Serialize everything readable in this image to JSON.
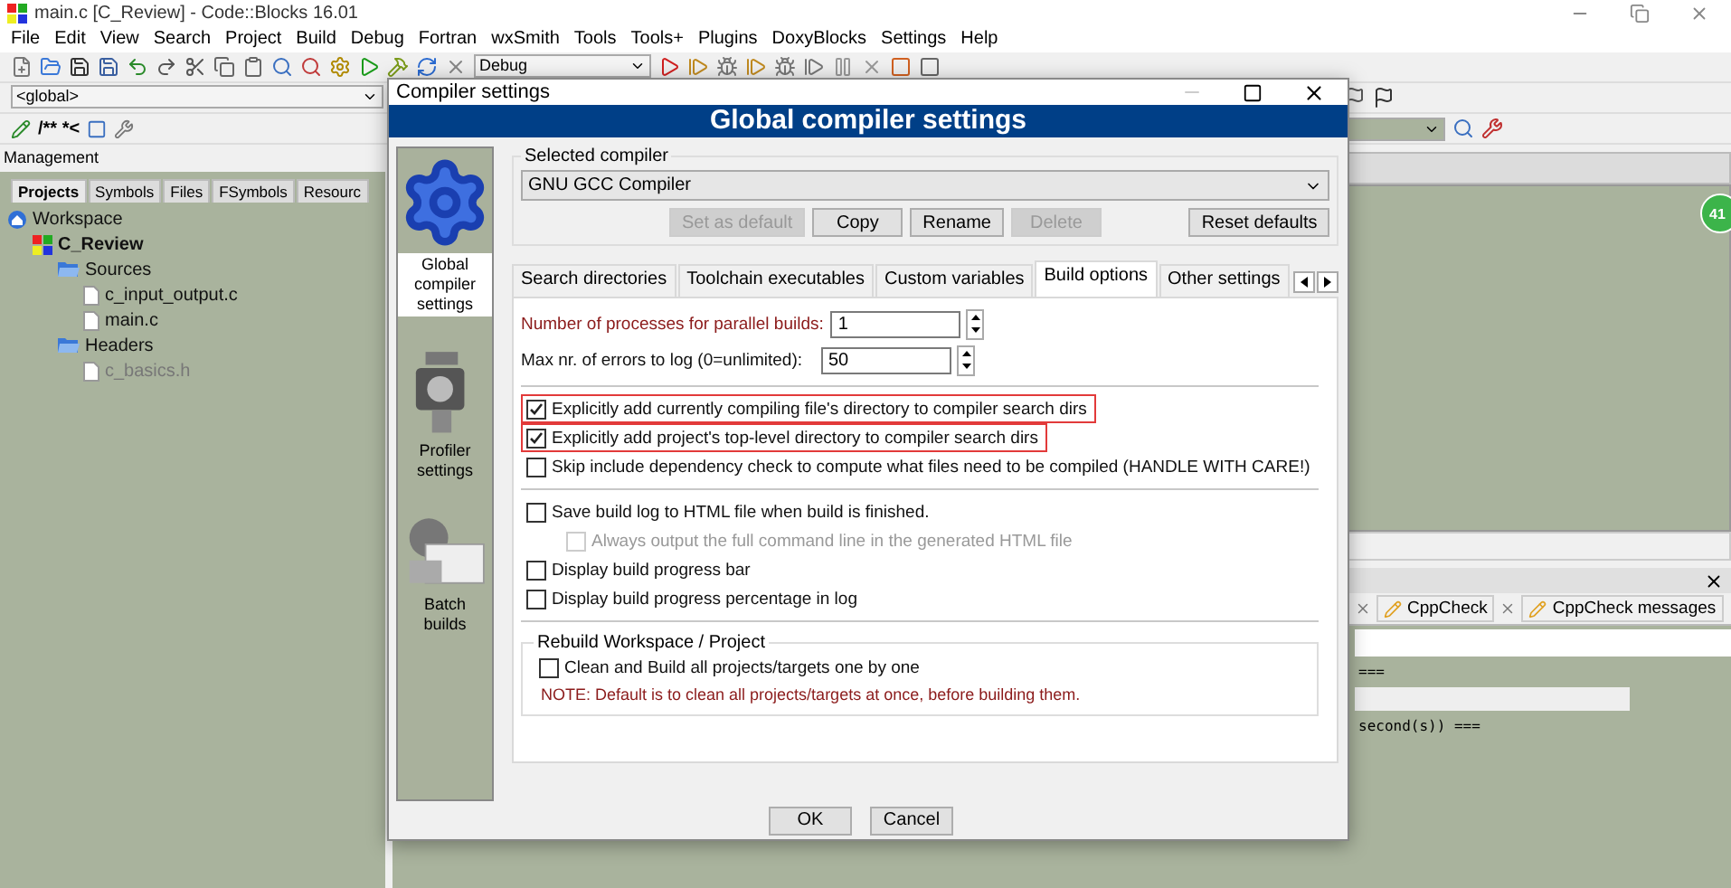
{
  "window": {
    "title": "main.c [C_Review] - Code::Blocks 16.01"
  },
  "menu": [
    "File",
    "Edit",
    "View",
    "Search",
    "Project",
    "Build",
    "Debug",
    "Fortran",
    "wxSmith",
    "Tools",
    "Tools+",
    "Plugins",
    "DoxyBlocks",
    "Settings",
    "Help"
  ],
  "toolbar": {
    "build_target": "Debug",
    "scope": "<global>",
    "doc_comment": "/** *<"
  },
  "management": {
    "title": "Management",
    "tabs": [
      {
        "label": "Projects",
        "selected": true
      },
      {
        "label": "Symbols",
        "selected": false
      },
      {
        "label": "Files",
        "selected": false
      },
      {
        "label": "FSymbols",
        "selected": false
      },
      {
        "label": "Resourc",
        "selected": false
      }
    ],
    "tree": [
      {
        "label": "Workspace",
        "kind": "workspace",
        "disabled": false,
        "children": [
          {
            "label": "C_Review",
            "kind": "project",
            "disabled": false,
            "children": [
              {
                "label": "Sources",
                "kind": "folder",
                "disabled": false,
                "children": [
                  {
                    "label": "c_input_output.c",
                    "kind": "file",
                    "disabled": false
                  },
                  {
                    "label": "main.c",
                    "kind": "file",
                    "disabled": false
                  }
                ]
              },
              {
                "label": "Headers",
                "kind": "folder",
                "disabled": false,
                "children": [
                  {
                    "label": "c_basics.h",
                    "kind": "file",
                    "disabled": true
                  }
                ]
              }
            ]
          }
        ]
      }
    ]
  },
  "editor": {
    "badge": "41"
  },
  "logs": {
    "tabs": [
      {
        "label": "CppCheck",
        "selected": false
      },
      {
        "label": "CppCheck messages",
        "selected": false
      }
    ],
    "lines": [
      {
        "kind": "blank"
      },
      {
        "text": "===",
        "kind": "plain"
      },
      {
        "kind": "shaded"
      },
      {
        "text": "second(s)) ===",
        "kind": "plain"
      }
    ]
  },
  "dialog": {
    "title": "Compiler settings",
    "banner": "Global compiler settings",
    "nav": [
      {
        "label": "Global compiler settings",
        "kind": "gear",
        "selected": true
      },
      {
        "label": "Profiler settings",
        "kind": "profiler",
        "selected": false
      },
      {
        "label": "Batch builds",
        "kind": "batch",
        "selected": false
      }
    ],
    "compiler_group": "Selected compiler",
    "compiler": "GNU GCC Compiler",
    "compiler_buttons": [
      {
        "label": "Set as default",
        "disabled": true
      },
      {
        "label": "Copy",
        "disabled": false
      },
      {
        "label": "Rename",
        "disabled": false
      },
      {
        "label": "Delete",
        "disabled": true
      },
      {
        "label": "Reset defaults",
        "disabled": false
      }
    ],
    "tabs": [
      {
        "label": "Search directories",
        "selected": false
      },
      {
        "label": "Toolchain executables",
        "selected": false
      },
      {
        "label": "Custom variables",
        "selected": false
      },
      {
        "label": "Build options",
        "selected": true
      },
      {
        "label": "Other settings",
        "selected": false
      }
    ],
    "fields": [
      {
        "label": "Number of processes for parallel builds:",
        "value": "1",
        "emphasized": true
      },
      {
        "label": "Max nr. of errors to log (0=unlimited):",
        "value": "50",
        "emphasized": false
      }
    ],
    "option_groups": [
      [
        {
          "label": "Explicitly add currently compiling file's directory to compiler search dirs",
          "checked": true,
          "disabled": false,
          "highlighted": true
        },
        {
          "label": "Explicitly add project's top-level directory to compiler search dirs",
          "checked": true,
          "disabled": false,
          "highlighted": true
        },
        {
          "label": "Skip include dependency check to compute what files need to be compiled (HANDLE WITH CARE!)",
          "checked": false,
          "disabled": false,
          "highlighted": false
        }
      ],
      [
        {
          "label": "Save build log to HTML file when build is finished.",
          "checked": false,
          "disabled": false,
          "highlighted": false,
          "children": [
            {
              "label": "Always output the full command line in the generated HTML file",
              "checked": false,
              "disabled": true,
              "highlighted": false
            }
          ]
        },
        {
          "label": "Display build progress bar",
          "checked": false,
          "disabled": false,
          "highlighted": false
        },
        {
          "label": "Display build progress percentage in log",
          "checked": false,
          "disabled": false,
          "highlighted": false
        }
      ]
    ],
    "rebuild": {
      "title": "Rebuild Workspace / Project",
      "option": {
        "label": "Clean and Build all projects/targets one by one",
        "checked": false
      },
      "note": "NOTE: Default is to clean all projects/targets at once, before building them."
    },
    "buttons": [
      "OK",
      "Cancel"
    ]
  }
}
